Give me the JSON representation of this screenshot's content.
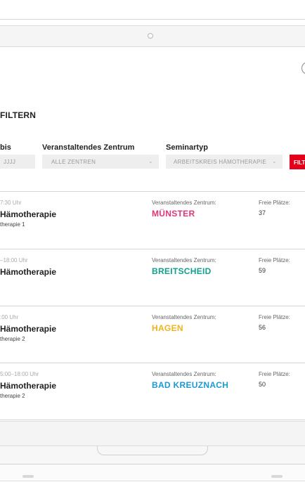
{
  "filter": {
    "heading": "FILTERN",
    "date_label": "bis",
    "date_placeholder": "JJJJ",
    "center_label": "Veranstaltendes Zentrum",
    "center_value": "ALLE ZENTREN",
    "type_label": "Seminartyp",
    "type_value": "ARBEITSKREIS HÄMOTHERAPIE",
    "submit_label": "FILTERN"
  },
  "events": [
    {
      "time": "7:30 Uhr",
      "title": "Hämotherapie",
      "subtitle": "therapie 1",
      "center_label": "Veranstaltendes Zentrum:",
      "center": "MÜNSTER",
      "center_color": "#e0367a",
      "seats_label": "Freie Plätze:",
      "seats": "37"
    },
    {
      "time": "–18:00 Uhr",
      "title": "Hämotherapie",
      "subtitle": "",
      "center_label": "Veranstaltendes Zentrum:",
      "center": "BREITSCHEID",
      "center_color": "#12a08c",
      "seats_label": "Freie Plätze:",
      "seats": "59"
    },
    {
      "time": ":00 Uhr",
      "title": "Hämotherapie",
      "subtitle": "therapie 2",
      "center_label": "Veranstaltendes Zentrum:",
      "center": "HAGEN",
      "center_color": "#f2b31b",
      "seats_label": "Freie Plätze:",
      "seats": "56"
    },
    {
      "time": "5:00–18:00 Uhr",
      "title": "Hämotherapie",
      "subtitle": "therapie 2",
      "center_label": "Veranstaltendes Zentrum:",
      "center": "BAD KREUZNACH",
      "center_color": "#1c9ad6",
      "seats_label": "Freie Plätze:",
      "seats": "50"
    }
  ],
  "icons": {
    "camera": "camera-icon",
    "chevron": "chevron-down-icon",
    "corner": "circle-icon"
  }
}
